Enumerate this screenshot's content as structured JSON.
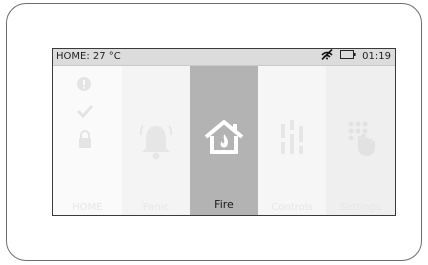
{
  "status": {
    "location_temp": "HOME: 27 °C",
    "time": "01:19"
  },
  "tiles": [
    {
      "label": "HOME"
    },
    {
      "label": "Panic"
    },
    {
      "label": "Fire"
    },
    {
      "label": "Controls"
    },
    {
      "label": "Settings"
    }
  ],
  "colors": {
    "selected_tile": "#b3b3b3",
    "statusbar": "#dcdcdc",
    "bezel": "#6e6e6e"
  }
}
